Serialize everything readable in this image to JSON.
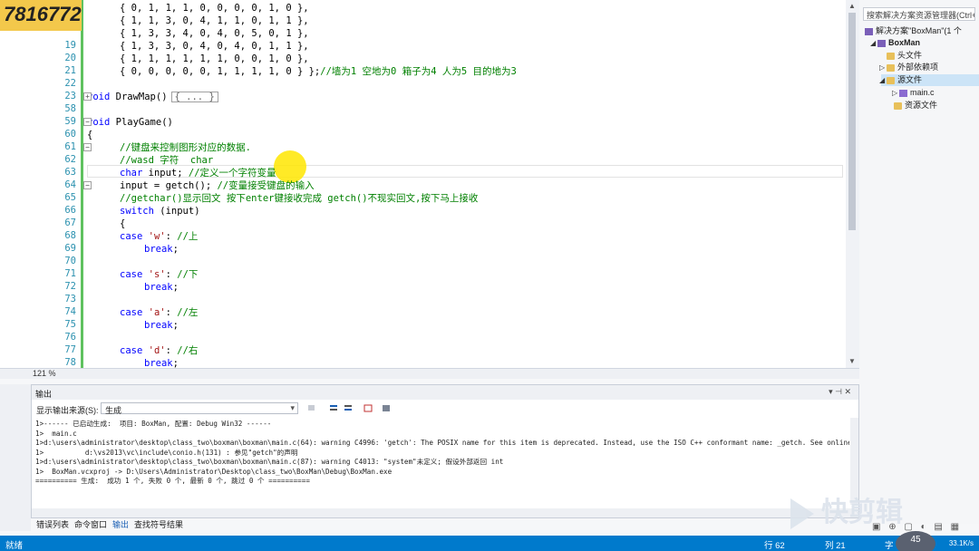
{
  "overlay_id": "7816772",
  "editor": {
    "line_numbers": [
      "",
      "",
      "",
      "",
      "",
      "",
      "",
      "",
      "",
      "",
      "",
      "",
      "",
      "",
      "",
      "",
      "",
      "",
      "",
      "",
      "",
      ""
    ],
    "lines": [
      {
        "num": "",
        "text": "{ 0, 1, 1, 1, 0, 0, 0, 0, 1, 0 },"
      },
      {
        "num": "",
        "text": "{ 1, 1, 3, 0, 4, 1, 1, 0, 1, 1 },"
      },
      {
        "num": "",
        "text": "{ 1, 3, 3, 4, 0, 4, 0, 5, 0, 1 },"
      },
      {
        "num": "19",
        "text": "{ 1, 3, 3, 0, 4, 0, 4, 0, 1, 1 },"
      },
      {
        "num": "20",
        "text": "{ 1, 1, 1, 1, 1, 1, 0, 0, 1, 0 },"
      },
      {
        "num": "21",
        "text": "{ 0, 0, 0, 0, 0, 1, 1, 1, 1, 0 } };//墙为1 空地为0 箱子为4 人为5 目的地为3"
      },
      {
        "num": "22",
        "text": ""
      },
      {
        "num": "23",
        "text": "void DrawMap()"
      },
      {
        "num": "58",
        "text": ""
      },
      {
        "num": "59",
        "text": "void PlayGame()"
      },
      {
        "num": "60",
        "text": "{"
      },
      {
        "num": "61",
        "text": "//键盘来控制图形对应的数据."
      },
      {
        "num": "62",
        "text": "//wasd 字符  char"
      },
      {
        "num": "63",
        "text": "char input; //定义一个字符变量"
      },
      {
        "num": "64",
        "text": "input = getch(); //变量接受键盘的输入"
      },
      {
        "num": "65",
        "text": "//getchar()显示回文 按下enter键接收完成 getch()不现实回文,按下马上接收"
      },
      {
        "num": "66",
        "text": "switch (input)"
      },
      {
        "num": "67",
        "text": "{"
      },
      {
        "num": "68",
        "text": "case 'w': //上"
      },
      {
        "num": "69",
        "text": "break;"
      },
      {
        "num": "70",
        "text": ""
      },
      {
        "num": "71",
        "text": "case 's': //下"
      },
      {
        "num": "72",
        "text": "break;"
      },
      {
        "num": "73",
        "text": ""
      },
      {
        "num": "74",
        "text": "case 'a': //左"
      },
      {
        "num": "75",
        "text": "break;"
      },
      {
        "num": "76",
        "text": ""
      },
      {
        "num": "77",
        "text": "case 'd': //右"
      },
      {
        "num": "78",
        "text": "break;"
      }
    ],
    "collapsed_marker": "{ ... }",
    "zoom": "121 %"
  },
  "solution_explorer": {
    "search_placeholder": "搜索解决方案资源管理器(Ctrl+",
    "solution_label": "解决方案\"BoxMan\"(1 个",
    "project": "BoxMan",
    "headers": "头文件",
    "external": "外部依赖项",
    "sources": "源文件",
    "main_c": "main.c",
    "resources": "资源文件"
  },
  "output": {
    "title": "输出",
    "source_label": "显示输出来源(S):",
    "source_value": "生成",
    "lines": [
      "1>------ 已启动生成:  项目: BoxMan, 配置: Debug Win32 ------",
      "1>  main.c",
      "1>d:\\users\\administrator\\desktop\\class_two\\boxman\\boxman\\main.c(64): warning C4996: 'getch': The POSIX name for this item is deprecated. Instead, use the ISO C++ conformant name: _getch. See online help fo",
      "1>          d:\\vs2013\\vc\\include\\conio.h(131) : 参见\"getch\"的声明",
      "1>d:\\users\\administrator\\desktop\\class_two\\boxman\\boxman\\main.c(87): warning C4013: \"system\"未定义; 假设外部返回 int",
      "1>  BoxMan.vcxproj -> D:\\Users\\Administrator\\Desktop\\class_two\\BoxMan\\Debug\\BoxMan.exe",
      "========== 生成:  成功 1 个, 失败 0 个, 最新 0 个, 跳过 0 个 =========="
    ],
    "tabs": [
      "错误列表",
      "命令窗口",
      "输出",
      "查找符号结果"
    ]
  },
  "status": {
    "ready": "就绪",
    "row": "行 62",
    "col": "列 21",
    "char": "字",
    "speed": "33.1K/s",
    "badge": "45"
  },
  "brand": "快剪辑"
}
